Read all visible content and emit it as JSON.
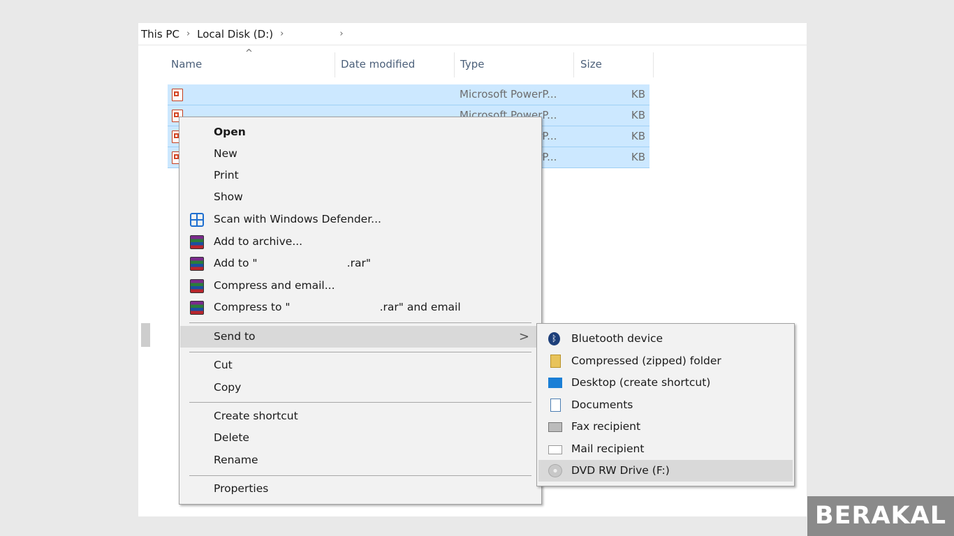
{
  "breadcrumb": {
    "items": [
      "This PC",
      "Local Disk (D:)",
      ""
    ]
  },
  "columns": {
    "name": "Name",
    "date": "Date modified",
    "type": "Type",
    "size": "Size",
    "sort_indicator": "^"
  },
  "files": [
    {
      "type": "Microsoft PowerP...",
      "size": "KB"
    },
    {
      "type": "Microsoft PowerP...",
      "size": "KB"
    },
    {
      "type": "Microsoft PowerP...",
      "size": "KB"
    },
    {
      "type": "Microsoft PowerP...",
      "size": "KB"
    }
  ],
  "context_menu": {
    "items": [
      {
        "label": "Open",
        "icon": null
      },
      {
        "label": "New",
        "icon": null
      },
      {
        "label": "Print",
        "icon": null
      },
      {
        "label": "Show",
        "icon": null
      },
      {
        "label": "Scan with Windows Defender...",
        "icon": "defender-icon"
      },
      {
        "label": "Add to archive...",
        "icon": "winrar-icon"
      },
      {
        "label": "Add to \"                          .rar\"",
        "icon": "winrar-icon"
      },
      {
        "label": "Compress and email...",
        "icon": "winrar-icon"
      },
      {
        "label": "Compress to \"                          .rar\" and email",
        "icon": "winrar-icon"
      },
      {
        "label": "Send to",
        "icon": null,
        "submenu_arrow": ">"
      },
      {
        "label": "Cut"
      },
      {
        "label": "Copy"
      },
      {
        "label": "Create shortcut"
      },
      {
        "label": "Delete"
      },
      {
        "label": "Rename"
      },
      {
        "label": "Properties"
      }
    ]
  },
  "send_to": {
    "items": [
      {
        "label": "Bluetooth device",
        "icon": "bluetooth-icon"
      },
      {
        "label": "Compressed (zipped) folder",
        "icon": "zip-folder-icon"
      },
      {
        "label": "Desktop (create shortcut)",
        "icon": "desktop-icon"
      },
      {
        "label": "Documents",
        "icon": "documents-icon"
      },
      {
        "label": "Fax recipient",
        "icon": "fax-icon"
      },
      {
        "label": "Mail recipient",
        "icon": "mail-icon"
      },
      {
        "label": "DVD RW Drive (F:)",
        "icon": "dvd-icon"
      }
    ]
  },
  "watermark": "BERAKAL",
  "colors": {
    "selection": "#cce8ff",
    "menu_bg": "#f2f2f2",
    "highlight": "#d9d9d9"
  }
}
